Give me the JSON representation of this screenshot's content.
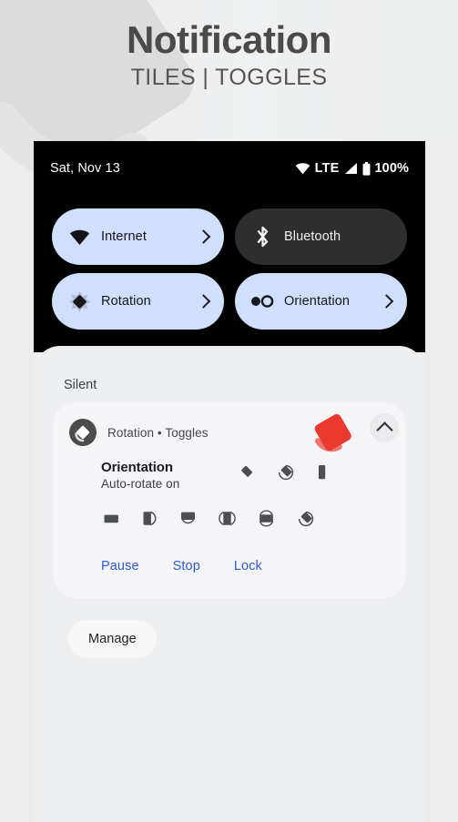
{
  "header": {
    "title": "Notification",
    "subtitle": "TILES | TOGGLES"
  },
  "phone": {
    "statusbar": {
      "date": "Sat, Nov 13",
      "wifi_icon": "wifi-icon",
      "network_label": "LTE",
      "signal_icon": "signal-bars-icon",
      "battery_icon": "battery-full-icon",
      "battery_percent": "100%"
    },
    "quick_settings": {
      "tiles": [
        {
          "label": "Internet",
          "icon": "wifi-icon",
          "state": "on",
          "has_chevron": true
        },
        {
          "label": "Bluetooth",
          "icon": "bluetooth-icon",
          "state": "off",
          "has_chevron": false
        },
        {
          "label": "Rotation",
          "icon": "rotation-icon",
          "state": "on",
          "has_chevron": true
        },
        {
          "label": "Orientation",
          "icon": "orientation-icon",
          "state": "on",
          "has_chevron": true
        }
      ]
    },
    "shade": {
      "section_label": "Silent",
      "notification": {
        "app_icon": "rotation-app-icon",
        "source": "Rotation • Toggles",
        "logo_icon": "rotation-logo-icon",
        "collapse_icon": "chevron-up-icon",
        "title": "Orientation",
        "subtitle": "Auto-rotate on",
        "status_icons": [
          "diamond-rotate-icon",
          "diamond-auto-rotate-icon",
          "portrait-lock-icon"
        ],
        "orientation_icons": [
          "landscape-icon",
          "portrait-right-icon",
          "landscape-reverse-icon",
          "portrait-both-icon",
          "landscape-both-icon",
          "auto-rotate-icon"
        ],
        "actions": [
          {
            "label": "Pause"
          },
          {
            "label": "Stop"
          },
          {
            "label": "Lock"
          }
        ]
      },
      "manage_label": "Manage"
    }
  },
  "colors": {
    "tile_on_bg": "#cfdffc",
    "tile_off_bg": "#2e2e2e",
    "action_blue": "#2f5ad0",
    "logo_red": "#ea3a30",
    "shade_bg": "#eeeff1",
    "card_bg": "#f5f5f7"
  }
}
